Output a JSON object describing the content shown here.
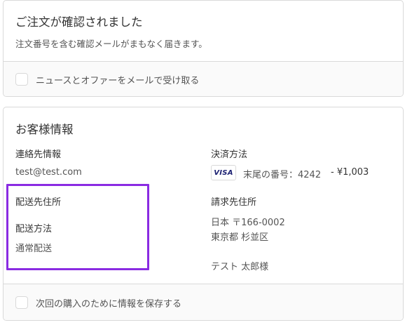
{
  "confirmation": {
    "title": "ご注文が確認されました",
    "subtitle": "注文番号を含む確認メールがまもなく届きます。",
    "newsletter_label": "ニュースとオファーをメールで受け取る"
  },
  "customer": {
    "title": "お客様情報",
    "contact_heading": "連絡先情報",
    "contact_email": "test@test.com",
    "shipping_address_heading": "配送先住所",
    "shipping_method_heading": "配送方法",
    "shipping_method_value": "通常配送",
    "payment_heading": "決済方法",
    "payment_card_brand": "VISA",
    "payment_detail": "末尾の番号：4242",
    "payment_amount": "- ¥1,003",
    "billing_heading": "請求先住所",
    "billing_line1": "日本 〒166-0002",
    "billing_line2": "東京都 杉並区",
    "billing_name": "テスト 太郎様",
    "save_info_label": "次回の購入のために情報を保存する"
  },
  "colors": {
    "highlight": "#8a2be2",
    "visa": "#1a1f71"
  }
}
